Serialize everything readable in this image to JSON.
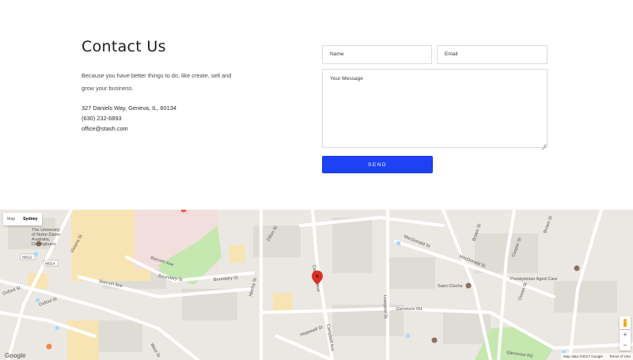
{
  "contact": {
    "title": "Contact Us",
    "description": "Because you have better things to do, like create, sell and grow your business.",
    "address": "327 Daniels Way, Geneva, IL, 60134",
    "phone": "(630) 232-6893",
    "email": "office@stash.com"
  },
  "form": {
    "name_placeholder": "Name",
    "email_placeholder": "Email",
    "message_placeholder": "Your Message",
    "send_label": "SEND",
    "button_color": "#1d42f5"
  },
  "map": {
    "type_map": "Map",
    "type_sydney": "Sydney",
    "zoom_in": "+",
    "zoom_out": "−",
    "logo": "Google",
    "map_data": "Map data ©2017 Google",
    "terms": "Terms of Use",
    "labels": {
      "university": "The University of Notre Dame Australia, Darlinghurst",
      "saint_cloche": "Saint Cloche",
      "presbyterian": "Presbyterian Aged Care",
      "barcom_ave": "Barcom Ave",
      "boundary_st": "Boundary St",
      "oxford_st": "Oxford St",
      "victoria_st": "Victoria St",
      "campbell_ave": "Campbell Ave",
      "liverpool_st": "Liverpool St",
      "macdonald_st": "MacDonald St",
      "glenmore_rd": "Glenmore Rd",
      "brown_st": "Brown St",
      "cooper_st": "Cooper St",
      "hopewell_st": "Hopewell St",
      "dillon_st": "Dillon St",
      "heeley_st": "Heeley St",
      "ocean_st": "Ocean St",
      "west_st": "West St"
    },
    "route_n6512": "N6512",
    "route_n6514": "N6514",
    "water_color": "#aadaff",
    "park_color": "#c5e8b0",
    "pin_color": "#d93025"
  }
}
